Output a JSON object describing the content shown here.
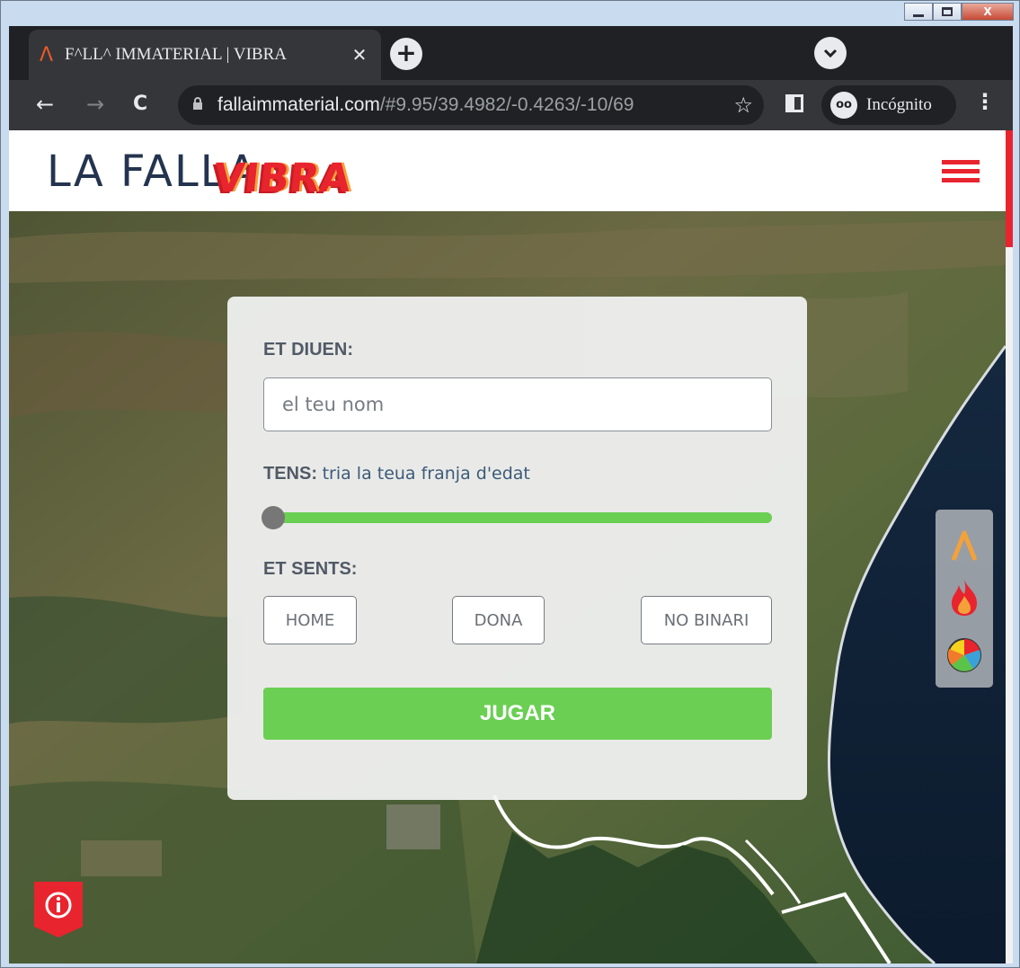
{
  "window": {
    "minimize_label": "",
    "maximize_label": "",
    "close_label": "X"
  },
  "browser": {
    "tab": {
      "favicon": "Λ",
      "title": "F^LL^ IMMATERIAL | VIBRA",
      "close": "✕"
    },
    "new_tab": "+",
    "tab_search": "⌄",
    "nav": {
      "back": "←",
      "forward": "→",
      "reload": "C"
    },
    "address": {
      "host": "fallaimmaterial.com",
      "path": "/#9.95/39.4982/-0.4263/-10/69"
    },
    "bookmark_star": "☆",
    "profile_label": "Incógnito",
    "incognito_glyph": "oo",
    "menu": "⋮"
  },
  "site": {
    "logo_text": "LA FALLA",
    "logo_overlay": "VIBRA",
    "accent_color": "#e8242e"
  },
  "form": {
    "name_label": "ET DIUEN:",
    "name_placeholder": "el teu nom",
    "age_label": "TENS:",
    "age_hint": "tria la teua franja d'edat",
    "age_slider_value": 0,
    "gender_label": "ET SENTS:",
    "gender_options": [
      "HOME",
      "DONA",
      "NO BINARI"
    ],
    "submit_label": "JUGAR",
    "button_color": "#6acf52"
  },
  "layers": {
    "icons": [
      "falla-logo-icon",
      "fire-icon",
      "pie-chart-icon"
    ]
  },
  "info": {
    "icon": "info-icon"
  }
}
